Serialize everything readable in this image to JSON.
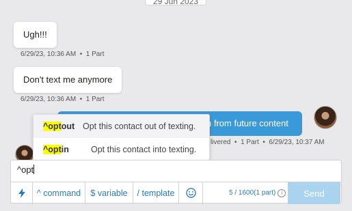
{
  "date_divider": "29 Jun 2023",
  "messages": [
    {
      "text": "Ugh!!!",
      "time": "6/29/23, 10:36 AM",
      "parts": "1 Part"
    },
    {
      "text": "Don't text me anymore",
      "time": "6/29/23, 10:36 AM",
      "parts": "1 Part"
    }
  ],
  "outgoing": {
    "text_visible": "u from future content",
    "status": "livered",
    "parts": "1 Part",
    "time": "6/29/23, 10:37 AM"
  },
  "autocomplete": {
    "items": [
      {
        "match": "^opt",
        "rest": "out",
        "description": "Opt this contact out of texting."
      },
      {
        "match": "^opt",
        "rest": "in",
        "description": "Opt this contact into texting."
      }
    ]
  },
  "composer": {
    "value": "^opt",
    "toolbar": {
      "lightning_icon": "lightning-icon",
      "command": "^ command",
      "variable": "$ variable",
      "template": "/ template",
      "emoji_icon": "smiley-icon",
      "counter": "5 / 1600(1 part)",
      "info": "i",
      "send": "Send"
    }
  },
  "colors": {
    "background": "#e9e9ec",
    "outgoing_bubble": "#3a9ad9",
    "accent": "#2a7bbf",
    "send_disabled": "#a9d3ef",
    "highlight": "#ffff00"
  }
}
